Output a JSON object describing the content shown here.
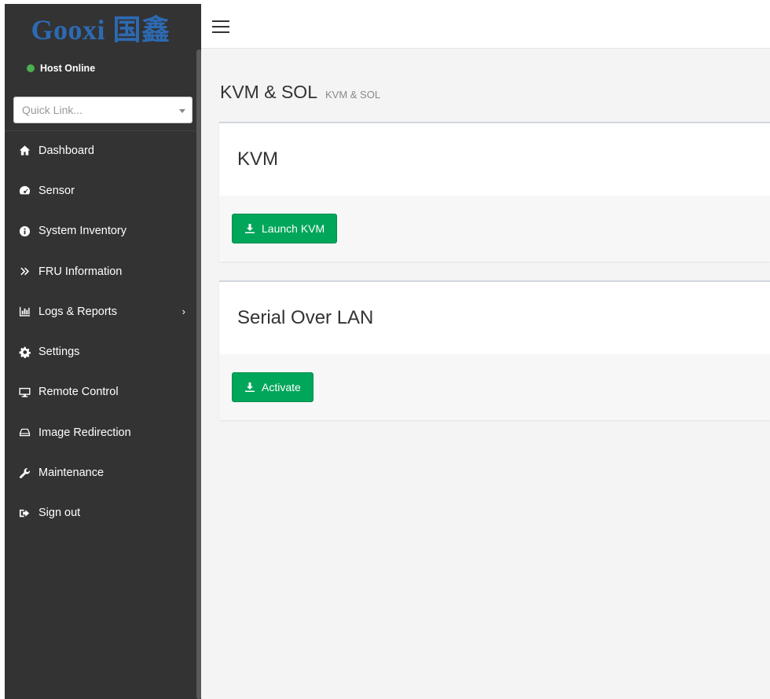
{
  "brand": {
    "logo_text": "Gooxi 国鑫"
  },
  "host": {
    "status_text": "Host Online",
    "status_color": "#4caf50"
  },
  "quick_link": {
    "placeholder": "Quick Link..."
  },
  "sidebar": {
    "items": [
      {
        "label": "Dashboard",
        "icon": "home-icon"
      },
      {
        "label": "Sensor",
        "icon": "dashboard-gauge-icon"
      },
      {
        "label": "System Inventory",
        "icon": "info-circle-icon"
      },
      {
        "label": "FRU Information",
        "icon": "double-chevron-icon"
      },
      {
        "label": "Logs & Reports",
        "icon": "bar-chart-icon",
        "has_submenu": true
      },
      {
        "label": "Settings",
        "icon": "gear-icon"
      },
      {
        "label": "Remote Control",
        "icon": "monitor-icon"
      },
      {
        "label": "Image Redirection",
        "icon": "drive-icon"
      },
      {
        "label": "Maintenance",
        "icon": "wrench-icon"
      },
      {
        "label": "Sign out",
        "icon": "sign-out-icon"
      }
    ]
  },
  "page": {
    "title": "KVM & SOL",
    "subtitle": "KVM & SOL"
  },
  "kvm_box": {
    "title": "KVM",
    "button_label": "Launch KVM"
  },
  "sol_box": {
    "title": "Serial Over LAN",
    "button_label": "Activate"
  },
  "colors": {
    "accent_green": "#00a65a",
    "sidebar_bg": "#333333",
    "brand_blue": "#2d6ab3"
  }
}
